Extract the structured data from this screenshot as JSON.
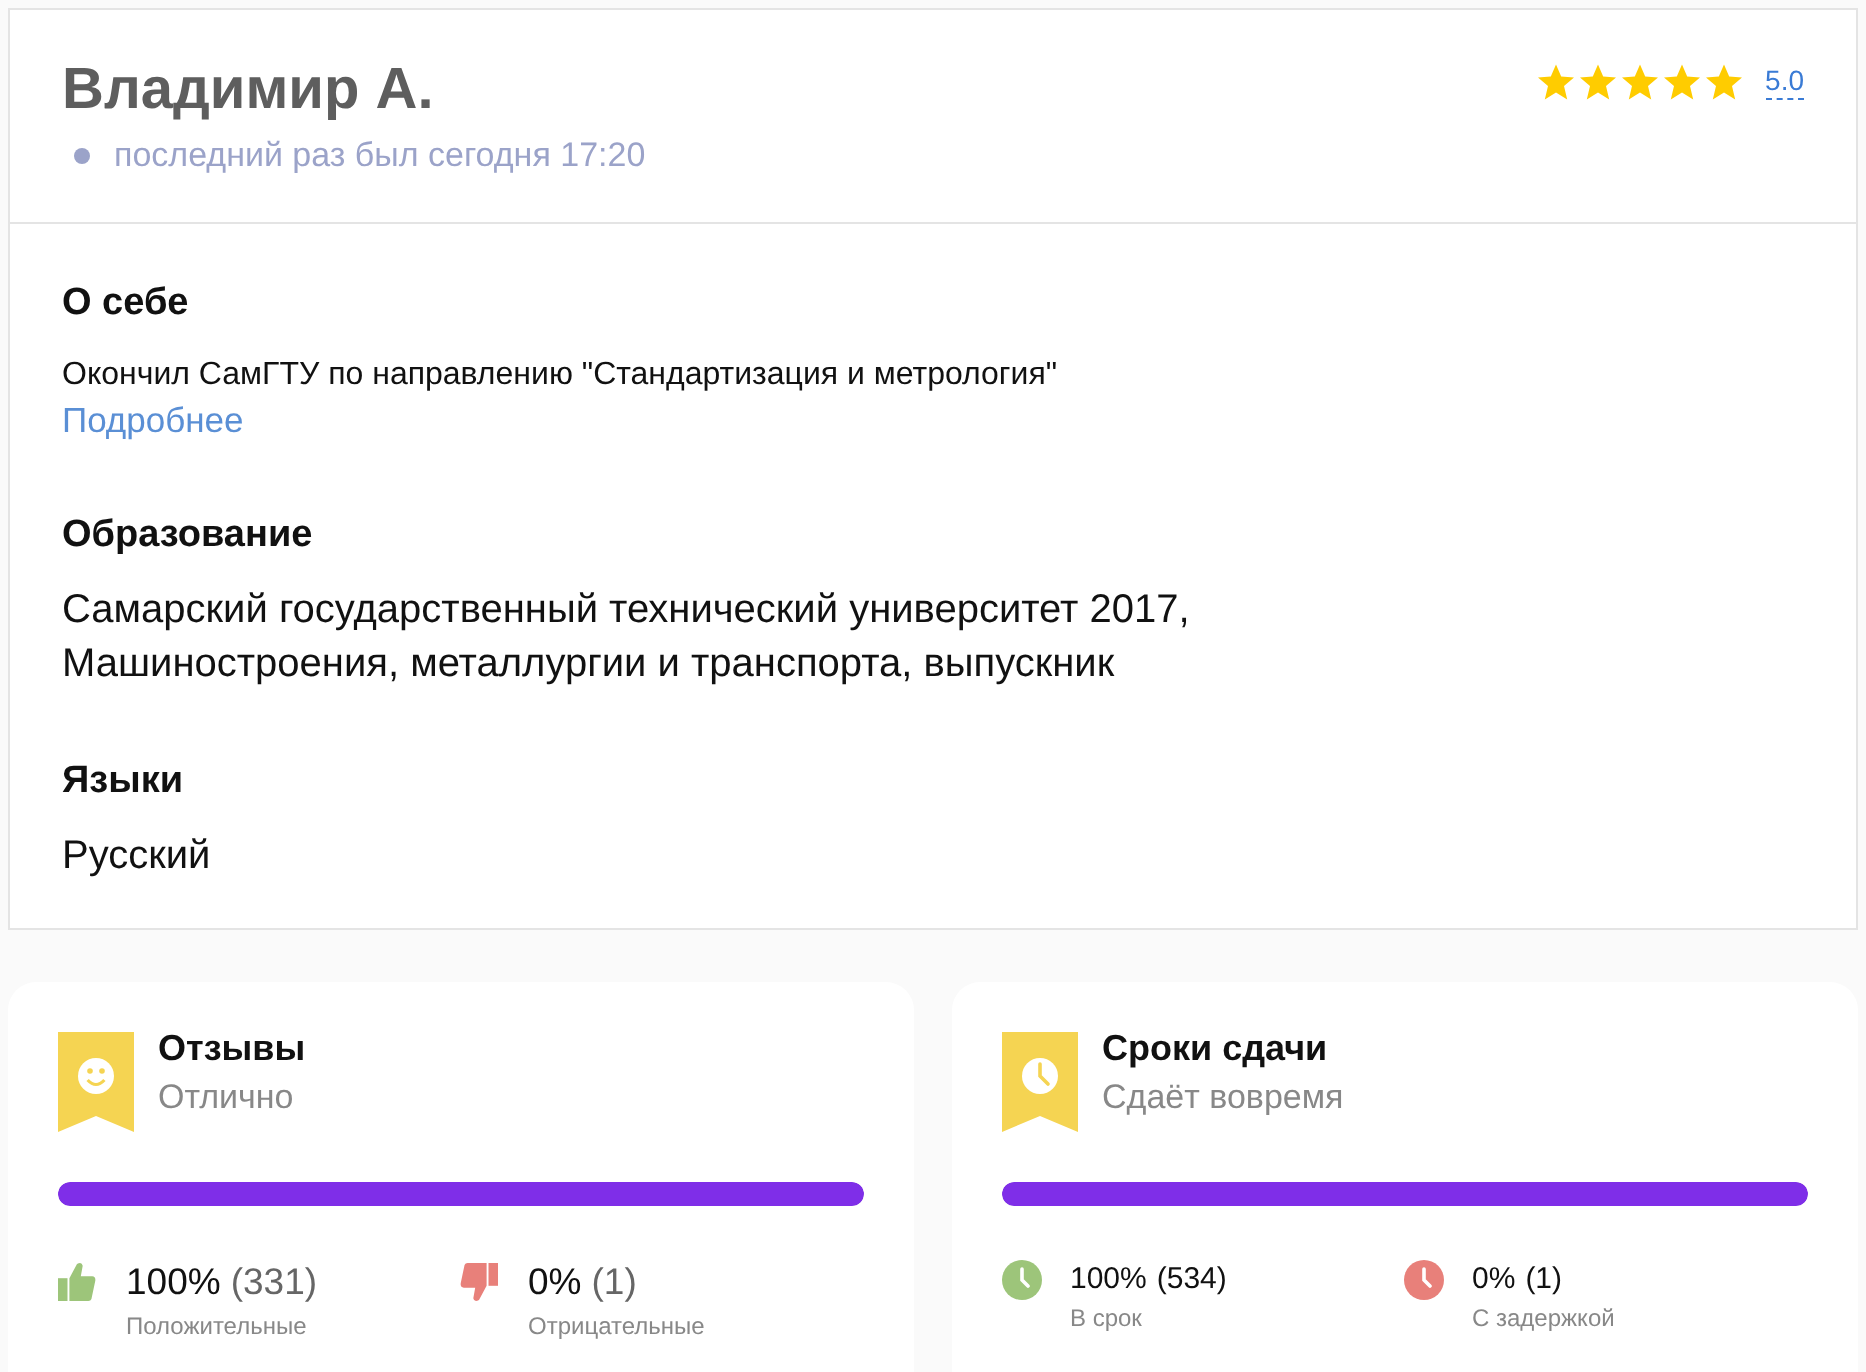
{
  "profile": {
    "name": "Владимир А.",
    "last_seen": "последний раз был сегодня 17:20",
    "stars": 5,
    "rating": "5.0"
  },
  "sections": [
    {
      "kind": "note",
      "title": "О себе",
      "text": "Окончил СамГТУ по направлению \"Стандартизация и метрология\"",
      "link": "Подробнее"
    },
    {
      "kind": "lines",
      "title": "Образование",
      "lines": [
        "Самарский государственный технический университет 2017,",
        "Машиностроения, металлургии и транспорта, выпускник"
      ]
    },
    {
      "kind": "lines",
      "title": "Языки",
      "lines": [
        "Русский"
      ]
    }
  ],
  "cards": [
    {
      "kind": "reviews",
      "title": "Отзывы",
      "subtitle": "Отлично",
      "level": 1,
      "stats": [
        {
          "kind": "positive",
          "percent": "100%",
          "count": "(331)",
          "label": "Положительные"
        },
        {
          "kind": "negative",
          "percent": "0%",
          "count": "(1)",
          "label": "Отрицательные"
        }
      ]
    },
    {
      "kind": "deadlines",
      "title": "Сроки сдачи",
      "subtitle": "Сдаёт вовремя",
      "level": 1,
      "stats": [
        {
          "kind": "positive",
          "percent": "100%",
          "count": "(534)",
          "label": "В срок"
        },
        {
          "kind": "negative",
          "percent": "0%",
          "count": "(1)",
          "label": "С задержкой"
        }
      ]
    }
  ]
}
